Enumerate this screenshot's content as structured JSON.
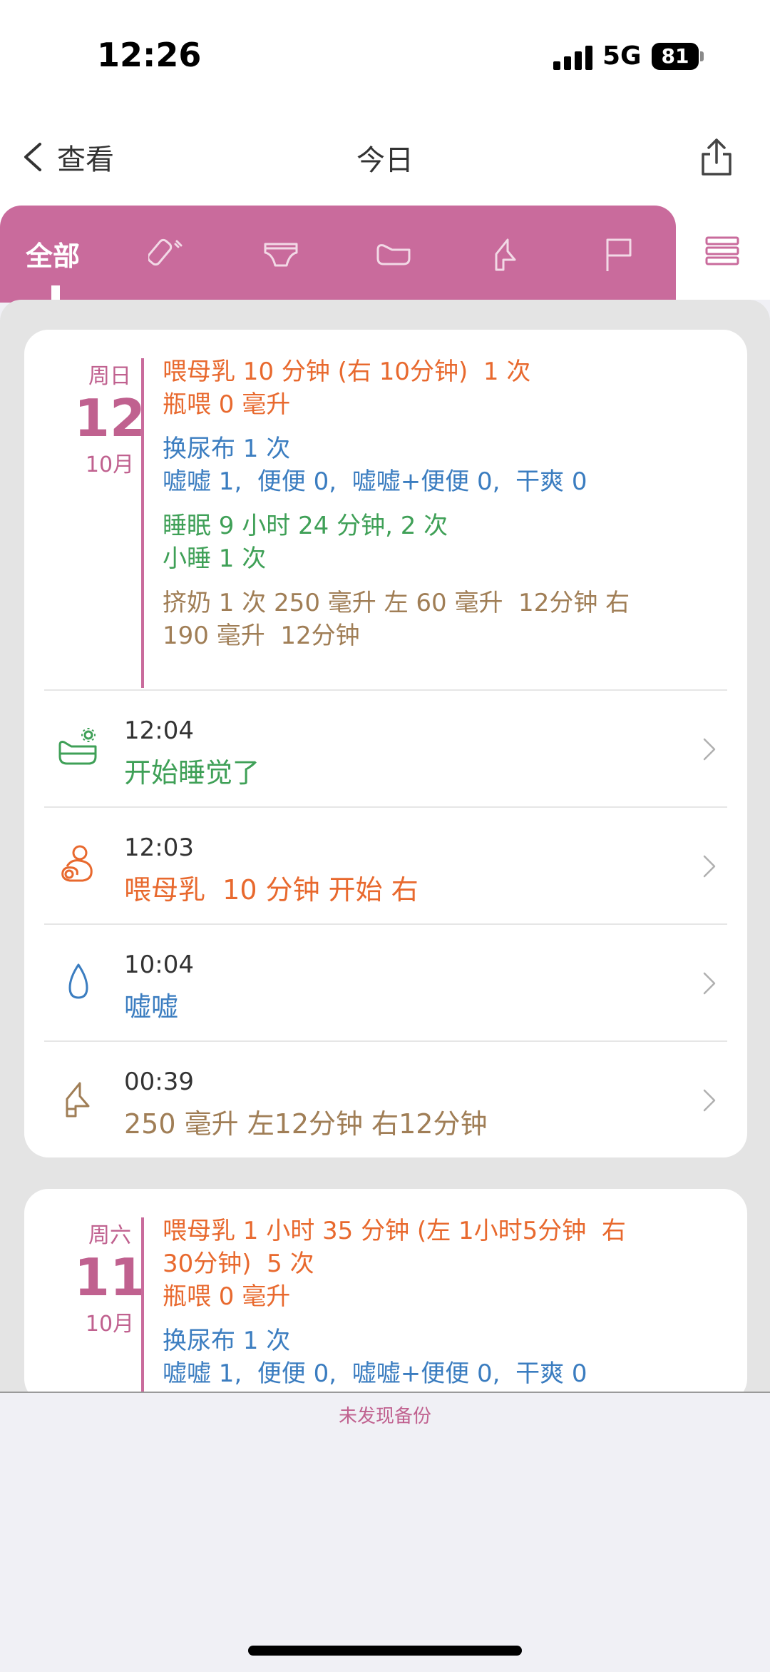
{
  "status_bar": {
    "time": "12:26",
    "network": "5G",
    "battery": "81"
  },
  "nav": {
    "back_label": "查看",
    "title": "今日"
  },
  "tabs": {
    "all_label": "全部",
    "icons": [
      "bottle-icon",
      "diaper-icon",
      "bassinet-icon",
      "breast-pump-icon",
      "flag-icon"
    ]
  },
  "days": [
    {
      "dow": "周日",
      "day": "12",
      "month": "10月",
      "summary": {
        "feed": [
          "喂母乳 10 分钟 (右 10分钟)  1 次",
          "瓶喂 0 毫升"
        ],
        "diaper": [
          "换尿布 1 次",
          "嘘嘘 1,  便便 0,  嘘嘘+便便 0,  干爽 0"
        ],
        "sleep": [
          "睡眠 9 小时 24 分钟, 2 次",
          "小睡 1 次"
        ],
        "pump": [
          "挤奶 1 次 250 毫升 左 60 毫升  12分钟 右",
          "190 毫升  12分钟"
        ]
      },
      "entries": [
        {
          "time": "12:04",
          "text": "开始睡觉了",
          "icon": "sleep-start-icon",
          "color": "#3fa057"
        },
        {
          "time": "12:03",
          "text": "喂母乳  10 分钟 开始 右",
          "icon": "breastfeeding-icon",
          "color": "#e8692e"
        },
        {
          "time": "10:04",
          "text": "嘘嘘",
          "icon": "pee-drop-icon",
          "color": "#3b7dc0"
        },
        {
          "time": "00:39",
          "text": "250 毫升 左12分钟 右12分钟",
          "icon": "breast-pump-icon",
          "color": "#a07e56"
        }
      ]
    },
    {
      "dow": "周六",
      "day": "11",
      "month": "10月",
      "summary": {
        "feed": [
          "喂母乳 1 小时 35 分钟 (左 1小时5分钟  右",
          "30分钟)  5 次",
          "瓶喂 0 毫升"
        ],
        "diaper": [
          "换尿布 1 次",
          "嘘嘘 1,  便便 0,  嘘嘘+便便 0,  干爽 0"
        ]
      }
    }
  ],
  "footer": {
    "backup_text": "未发现备份"
  },
  "colors": {
    "accent": "#c96b9c",
    "feed": "#e8692e",
    "diaper": "#3b7dc0",
    "sleep": "#3fa057",
    "pump": "#a07e56"
  }
}
